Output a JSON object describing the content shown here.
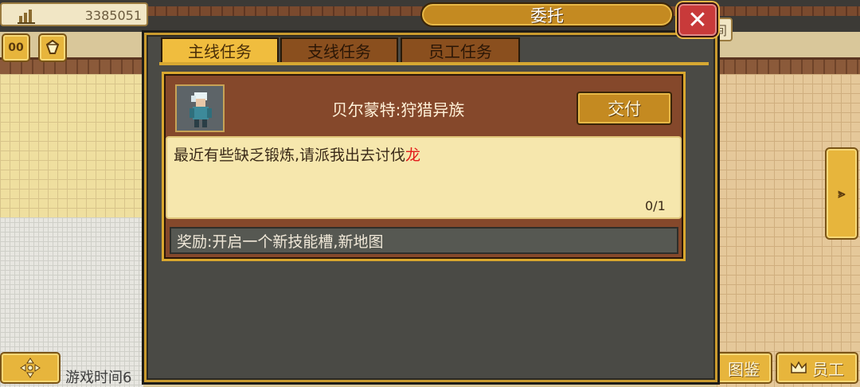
{
  "hud": {
    "money": "3385051",
    "game_time_label": "游戏时间6",
    "overlap_char": "间"
  },
  "dialog": {
    "title": "委托",
    "close_symbol": "✕",
    "tabs": [
      {
        "label": "主线任务",
        "active": true
      },
      {
        "label": "支线任务",
        "active": false
      },
      {
        "label": "员工任务",
        "active": false
      }
    ]
  },
  "quest": {
    "title": "贝尔蒙特:狩猎异族",
    "submit_label": "交付",
    "description_prefix": "最近有些缺乏锻炼,请派我出去讨伐",
    "description_highlight": "龙",
    "progress": "0/1",
    "reward": "奖励:开启一个新技能槽,新地图"
  },
  "buttons": {
    "pause_label": "00",
    "encyclopedia_label": "图鉴",
    "staff_label": "员工"
  },
  "icons": {
    "money": "building-chart-icon",
    "pause": "pause-icon",
    "gem": "gem-icon",
    "dpad": "dpad-icon",
    "forward": "fast-forward-icon",
    "crown": "crown-icon"
  },
  "colors": {
    "accent_gold": "#e7b53c",
    "close_red": "#c83a3a",
    "highlight_red": "#e21b1b",
    "card_brown": "#85482b"
  }
}
